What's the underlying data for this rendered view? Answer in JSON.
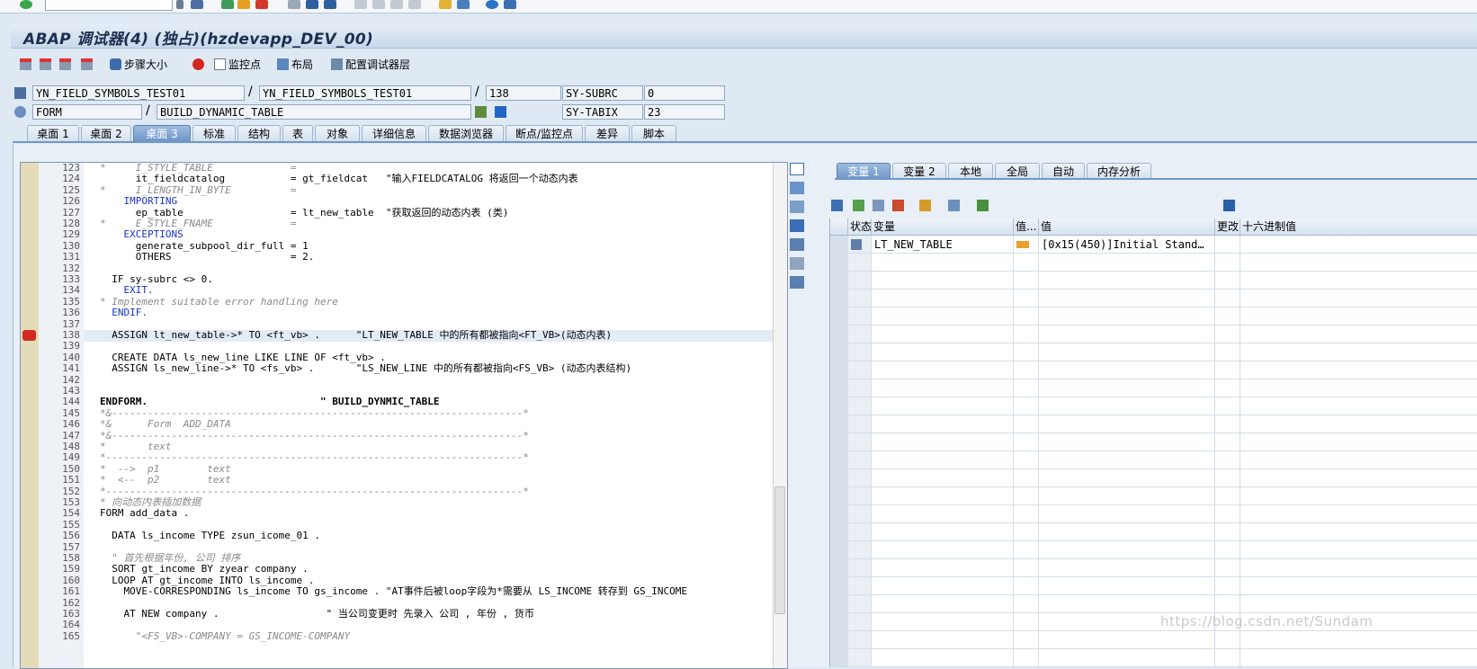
{
  "window": {
    "title": "ABAP 调试器(4) (独占)(hzdevapp_DEV_00)"
  },
  "app_toolbar": {
    "step_size": "步骤大小",
    "watchpoints": "监控点",
    "layout": "布局",
    "configure": "配置调试器层"
  },
  "context": {
    "program1": "YN_FIELD_SYMBOLS_TEST01",
    "program2": "YN_FIELD_SYMBOLS_TEST01",
    "line": "138",
    "type": "FORM",
    "routine": "BUILD_DYNAMIC_TABLE",
    "sy_label_1": "SY-SUBRC",
    "sy_value_1": "0",
    "sy_label_2": "SY-TABIX",
    "sy_value_2": "23",
    "slash": "/"
  },
  "tabs": [
    "桌面 1",
    "桌面 2",
    "桌面 3",
    "标准",
    "结构",
    "表",
    "对象",
    "详细信息",
    "数据浏览器",
    "断点/监控点",
    "差异",
    "脚本"
  ],
  "code": {
    "lines": [
      {
        "n": "123",
        "t": "*     I_STYLE_TABLE             =",
        "c": "cmt"
      },
      {
        "n": "124",
        "t": "      it_fieldcatalog           = gt_fieldcat   \"输入FIELDCATALOG 将返回一个动态内表",
        "c": ""
      },
      {
        "n": "125",
        "t": "*     I_LENGTH_IN_BYTE          =",
        "c": "cmt"
      },
      {
        "n": "126",
        "t": "    IMPORTING",
        "c": "kw"
      },
      {
        "n": "127",
        "t": "      ep_table                  = lt_new_table  \"获取返回的动态内表 (类)",
        "c": ""
      },
      {
        "n": "128",
        "t": "*     E_STYLE_FNAME             =",
        "c": "cmt"
      },
      {
        "n": "129",
        "t": "    EXCEPTIONS",
        "c": "kw"
      },
      {
        "n": "130",
        "t": "      generate_subpool_dir_full = 1",
        "c": ""
      },
      {
        "n": "131",
        "t": "      OTHERS                    = 2.",
        "c": ""
      },
      {
        "n": "132",
        "t": "",
        "c": ""
      },
      {
        "n": "133",
        "t": "  IF sy-subrc <> 0.",
        "c": ""
      },
      {
        "n": "134",
        "t": "    EXIT.",
        "c": "kw"
      },
      {
        "n": "135",
        "t": "* Implement suitable error handling here",
        "c": "cmt"
      },
      {
        "n": "136",
        "t": "  ENDIF.",
        "c": "kw"
      },
      {
        "n": "137",
        "t": "",
        "c": ""
      },
      {
        "n": "138",
        "t": "  ASSIGN lt_new_table->* TO <ft_vb> .      \"LT_NEW_TABLE 中的所有都被指向<FT_VB>(动态内表)",
        "c": ""
      },
      {
        "n": "139",
        "t": "",
        "c": ""
      },
      {
        "n": "140",
        "t": "  CREATE DATA ls_new_line LIKE LINE OF <ft_vb> .",
        "c": ""
      },
      {
        "n": "141",
        "t": "  ASSIGN ls_new_line->* TO <fs_vb> .       \"LS_NEW_LINE 中的所有都被指向<FS_VB> (动态内表结构)",
        "c": ""
      },
      {
        "n": "142",
        "t": "",
        "c": ""
      },
      {
        "n": "143",
        "t": "",
        "c": ""
      },
      {
        "n": "144",
        "t": "ENDFORM.                             \" BUILD_DYNMIC_TABLE",
        "c": "bold"
      },
      {
        "n": "145",
        "t": "*&---------------------------------------------------------------------*",
        "c": "cmt"
      },
      {
        "n": "146",
        "t": "*&      Form  ADD_DATA",
        "c": "cmt"
      },
      {
        "n": "147",
        "t": "*&---------------------------------------------------------------------*",
        "c": "cmt"
      },
      {
        "n": "148",
        "t": "*       text",
        "c": "cmt"
      },
      {
        "n": "149",
        "t": "*----------------------------------------------------------------------*",
        "c": "cmt"
      },
      {
        "n": "150",
        "t": "*  -->  p1        text",
        "c": "cmt"
      },
      {
        "n": "151",
        "t": "*  <--  p2        text",
        "c": "cmt"
      },
      {
        "n": "152",
        "t": "*----------------------------------------------------------------------*",
        "c": "cmt"
      },
      {
        "n": "153",
        "t": "* 向动态内表插加数据",
        "c": "cmt"
      },
      {
        "n": "154",
        "t": "FORM add_data .",
        "c": ""
      },
      {
        "n": "155",
        "t": "",
        "c": ""
      },
      {
        "n": "156",
        "t": "  DATA ls_income TYPE zsun_icome_01 .",
        "c": ""
      },
      {
        "n": "157",
        "t": "",
        "c": ""
      },
      {
        "n": "158",
        "t": "  \" 首先根据年份, 公司 排序",
        "c": "cmt"
      },
      {
        "n": "159",
        "t": "  SORT gt_income BY zyear company .",
        "c": ""
      },
      {
        "n": "160",
        "t": "  LOOP AT gt_income INTO ls_income .",
        "c": ""
      },
      {
        "n": "161",
        "t": "    MOVE-CORRESPONDING ls_income TO gs_income . \"AT事件后被loop字段为*需要从 LS_INCOME 转存到 GS_INCOME",
        "c": ""
      },
      {
        "n": "162",
        "t": "",
        "c": ""
      },
      {
        "n": "163",
        "t": "    AT NEW company .                  \" 当公司变更时 先录入 公司 , 年份 , 货币",
        "c": ""
      },
      {
        "n": "164",
        "t": "",
        "c": ""
      },
      {
        "n": "165",
        "t": "      \"<FS_VB>-COMPANY = GS_INCOME-COMPANY",
        "c": "cmt"
      }
    ]
  },
  "var_tabs": [
    "变量 1",
    "变量 2",
    "本地",
    "全局",
    "自动",
    "内存分析"
  ],
  "var_grid": {
    "headers": {
      "status": "状态",
      "variable": "变量",
      "valtype": "值...",
      "value": "值",
      "changed": "更改",
      "hex": "十六进制值"
    },
    "rows": [
      {
        "variable": "LT_NEW_TABLE",
        "value": "[0x15(450)]Initial Stand…"
      }
    ]
  },
  "watermark": "https://blog.csdn.net/Sundam",
  "icons": [
    "check-icon",
    "save-icon",
    "back-icon",
    "exit-icon",
    "cancel-icon",
    "print-icon",
    "find-icon",
    "help-icon",
    "step-into-icon",
    "step-over-icon",
    "return-icon",
    "continue-icon",
    "stop-icon",
    "watchpoint-icon",
    "layout-icon",
    "config-icon",
    "breakpoint-icon",
    "info-icon",
    "delete-icon",
    "arrow-icon"
  ]
}
